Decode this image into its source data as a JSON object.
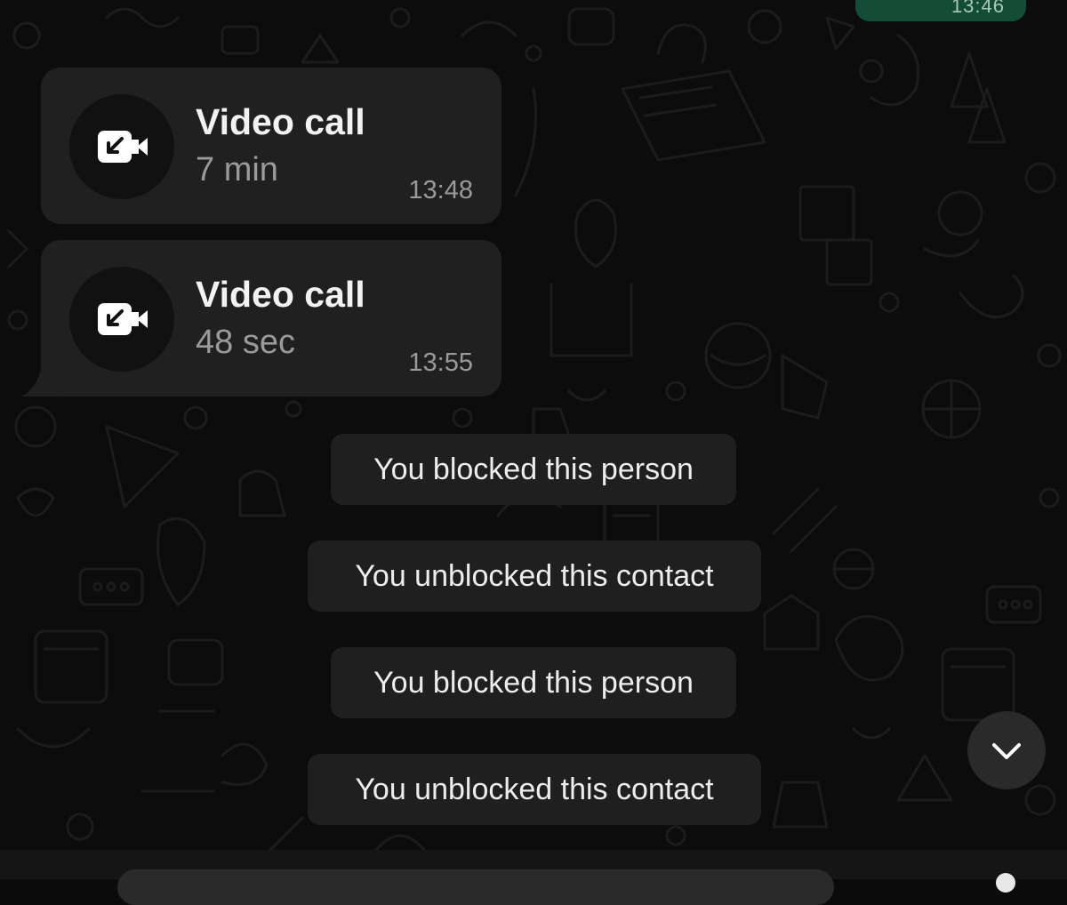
{
  "chat": {
    "outgoing_top": {
      "time": "13:46"
    },
    "calls": [
      {
        "title": "Video call",
        "duration": "7 min",
        "time": "13:48",
        "icon": "incoming-video-call-icon"
      },
      {
        "title": "Video call",
        "duration": "48 sec",
        "time": "13:55",
        "icon": "incoming-video-call-icon"
      }
    ],
    "system_messages": [
      "You blocked this person",
      "You unblocked this contact",
      "You blocked this person",
      "You unblocked this contact"
    ]
  },
  "controls": {
    "scroll_down_icon": "chevron-down-icon"
  },
  "colors": {
    "background": "#0c0c0c",
    "bubble_incoming": "#202020",
    "bubble_outgoing": "#144d37",
    "system_message": "#1f1f1f",
    "primary_text": "#f2f2f2",
    "secondary_text": "#9a9a9a"
  }
}
